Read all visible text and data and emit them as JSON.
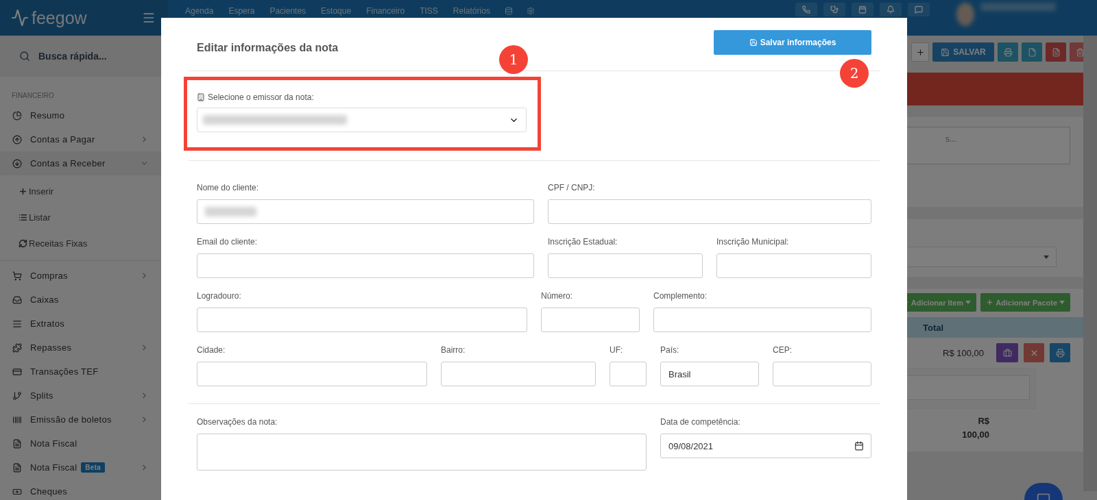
{
  "topbar": {
    "logo": "feegow",
    "nav": [
      "Agenda",
      "Espera",
      "Pacientes",
      "Estoque",
      "Financeiro",
      "TISS",
      "Relatórios"
    ]
  },
  "sidebar": {
    "search_placeholder": "Busca rápida...",
    "section": "FINANCEIRO",
    "items": [
      {
        "label": "Resumo",
        "submenu": false
      },
      {
        "label": "Contas a Pagar",
        "submenu": true,
        "expanded": false
      },
      {
        "label": "Contas a Receber",
        "submenu": true,
        "expanded": true,
        "children": [
          {
            "label": "Inserir"
          },
          {
            "label": "Listar"
          },
          {
            "label": "Receitas Fixas"
          }
        ]
      },
      {
        "label": "Compras",
        "submenu": true,
        "expanded": false
      },
      {
        "label": "Caixas",
        "submenu": false
      },
      {
        "label": "Extratos",
        "submenu": false
      },
      {
        "label": "Repasses",
        "submenu": true,
        "expanded": false
      },
      {
        "label": "Transações TEF",
        "submenu": false
      },
      {
        "label": "Splits",
        "submenu": true,
        "expanded": false
      },
      {
        "label": "Emissão de boletos",
        "submenu": true,
        "expanded": false
      },
      {
        "label": "Nota Fiscal",
        "submenu": false
      },
      {
        "label": "Nota Fiscal",
        "submenu": true,
        "expanded": false,
        "badge": "Beta"
      },
      {
        "label": "Cheques",
        "submenu": false
      }
    ]
  },
  "background": {
    "save_button": "SALVAR",
    "notes_placeholder": "s...",
    "item_buttons": [
      "Adicionar Item",
      "Adicionar Pacote"
    ],
    "table_header": "Total",
    "row_total": "R$ 100,00",
    "sum_total": "R$ 100,00"
  },
  "modal": {
    "title": "Editar informações da nota",
    "save_button": "Salvar informações",
    "issuer_label": "Selecione o emissor da nota:",
    "annotations": [
      "1",
      "2"
    ],
    "form_rows": [
      {
        "fields": [
          {
            "label": "Nome do cliente:",
            "kind": "text",
            "redacted": true
          },
          {
            "label": "CPF / CNPJ:",
            "kind": "text"
          }
        ]
      },
      {
        "fields": [
          {
            "label": "Email do cliente:",
            "kind": "text"
          },
          {
            "label": "Inscrição Estadual:",
            "kind": "text"
          },
          {
            "label": "Inscrição Municipal:",
            "kind": "text"
          }
        ]
      },
      {
        "fields": [
          {
            "label": "Logradouro:",
            "kind": "text"
          },
          {
            "label": "Número:",
            "kind": "text"
          },
          {
            "label": "Complemento:",
            "kind": "text"
          }
        ]
      },
      {
        "fields": [
          {
            "label": "Cidade:",
            "kind": "text"
          },
          {
            "label": "Bairro:",
            "kind": "text"
          },
          {
            "label": "UF:",
            "kind": "text"
          },
          {
            "label": "País:",
            "kind": "text",
            "value": "Brasil"
          },
          {
            "label": "CEP:",
            "kind": "text"
          }
        ]
      },
      {
        "fields": [
          {
            "label": "Observações da nota:",
            "kind": "textarea"
          },
          {
            "label": "Data de competência:",
            "kind": "date",
            "value": "09/08/2021"
          }
        ]
      }
    ]
  }
}
